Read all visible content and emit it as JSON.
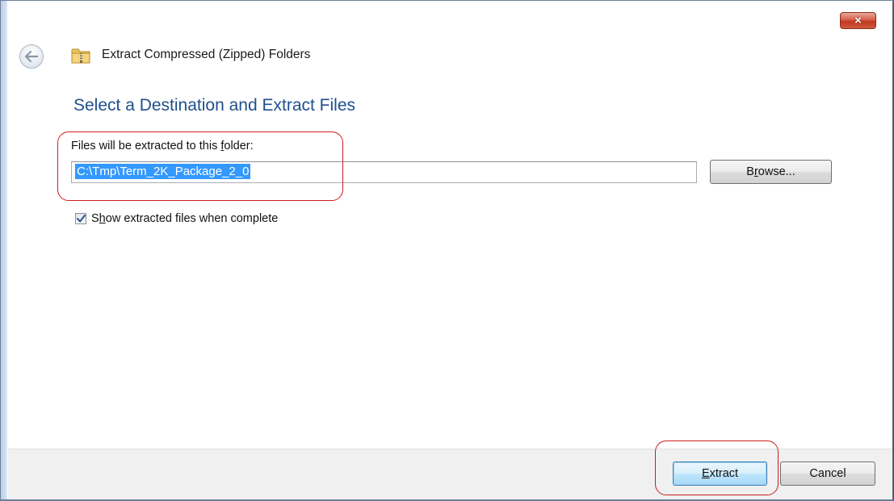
{
  "window": {
    "title": "Extract Compressed (Zipped) Folders",
    "close_label": "×"
  },
  "icons": {
    "back": "back-arrow-icon",
    "folder": "zip-folder-icon",
    "close": "close-icon",
    "checkmark": "checkmark-icon"
  },
  "content": {
    "heading": "Select a Destination and Extract Files",
    "field_label_pre": "Files will be extracted to this ",
    "field_label_accel": "f",
    "field_label_post": "older:",
    "path_value": "C:\\Tmp\\Term_2K_Package_2_0",
    "browse_pre": "B",
    "browse_accel": "r",
    "browse_post": "owse...",
    "checkbox_checked": true,
    "checkbox_pre": "S",
    "checkbox_accel": "h",
    "checkbox_post": "ow extracted files when complete"
  },
  "footer": {
    "extract_accel": "E",
    "extract_post": "xtract",
    "cancel_label": "Cancel"
  },
  "colors": {
    "heading": "#1e4f8c",
    "highlight": "#d01c1c",
    "selection": "#3399ff"
  }
}
